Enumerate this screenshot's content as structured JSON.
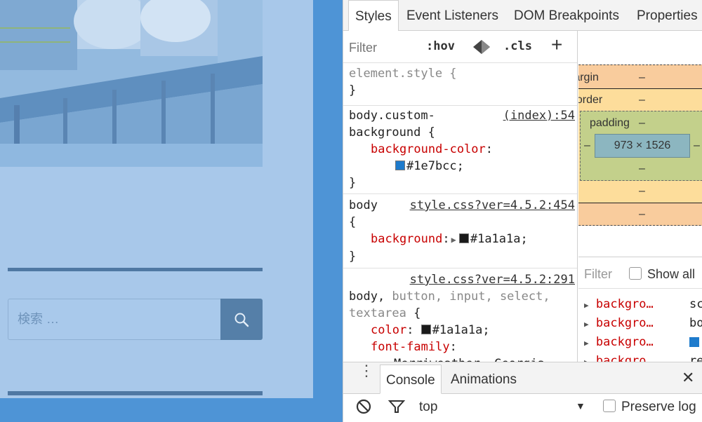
{
  "page": {
    "search_placeholder": "検索 …"
  },
  "devtools": {
    "tabs": [
      "Styles",
      "Event Listeners",
      "DOM Breakpoints",
      "Properties"
    ],
    "filter_placeholder": "Filter",
    "hov": ":hov",
    "cls": ".cls",
    "add": "+",
    "rules": {
      "r1": {
        "selector": "element.style {",
        "close": "}"
      },
      "r2": {
        "source": "(index):54",
        "selector1": "body.custom-",
        "selector2": "background {",
        "prop": "background-color",
        "colon": ":",
        "value": "#1e7bcc;",
        "swatch": "#1e7bcc",
        "close": "}"
      },
      "r3": {
        "selector": "body",
        "source": "style.css?ver=4.5.2:454",
        "open": "{",
        "prop": "background",
        "colon": ":",
        "value": "#1a1a1a;",
        "swatch": "#1a1a1a",
        "close": "}"
      },
      "r4": {
        "source": "style.css?ver=4.5.2:291",
        "sel_body": "body,",
        "sel_rest": " button, input, select,",
        "sel_line2": "textarea",
        "open": " {",
        "prop1": "color",
        "colon1": ":",
        "value1": "#1a1a1a;",
        "swatch1": "#1a1a1a",
        "prop2": "font-family",
        "colon2": ":",
        "value2": "Merriweather, Georgia,"
      }
    },
    "boxmodel": {
      "margin_label": "margin",
      "border_label": "border",
      "padding_label": "padding",
      "content": "973 × 1526",
      "dash": "–",
      "margin_color": "#f9cc9d",
      "border_color": "#fddd9b",
      "padding_color": "#c3d08b",
      "content_color": "#8cb6c0"
    },
    "computed": {
      "filter_placeholder": "Filter",
      "show_all": "Show all",
      "rows": [
        {
          "name": "backgro…",
          "value": "sc"
        },
        {
          "name": "backgro…",
          "value": "bo"
        },
        {
          "name": "backgro…",
          "value": ""
        },
        {
          "name": "backgro…",
          "value": "re"
        }
      ]
    },
    "drawer": {
      "tabs": [
        "Console",
        "Animations"
      ],
      "close": "✕",
      "context": "top",
      "preserve_log": "Preserve log"
    }
  },
  "colors": {
    "page_bg": "#4e94d6",
    "accent": "#1e7bcc"
  }
}
